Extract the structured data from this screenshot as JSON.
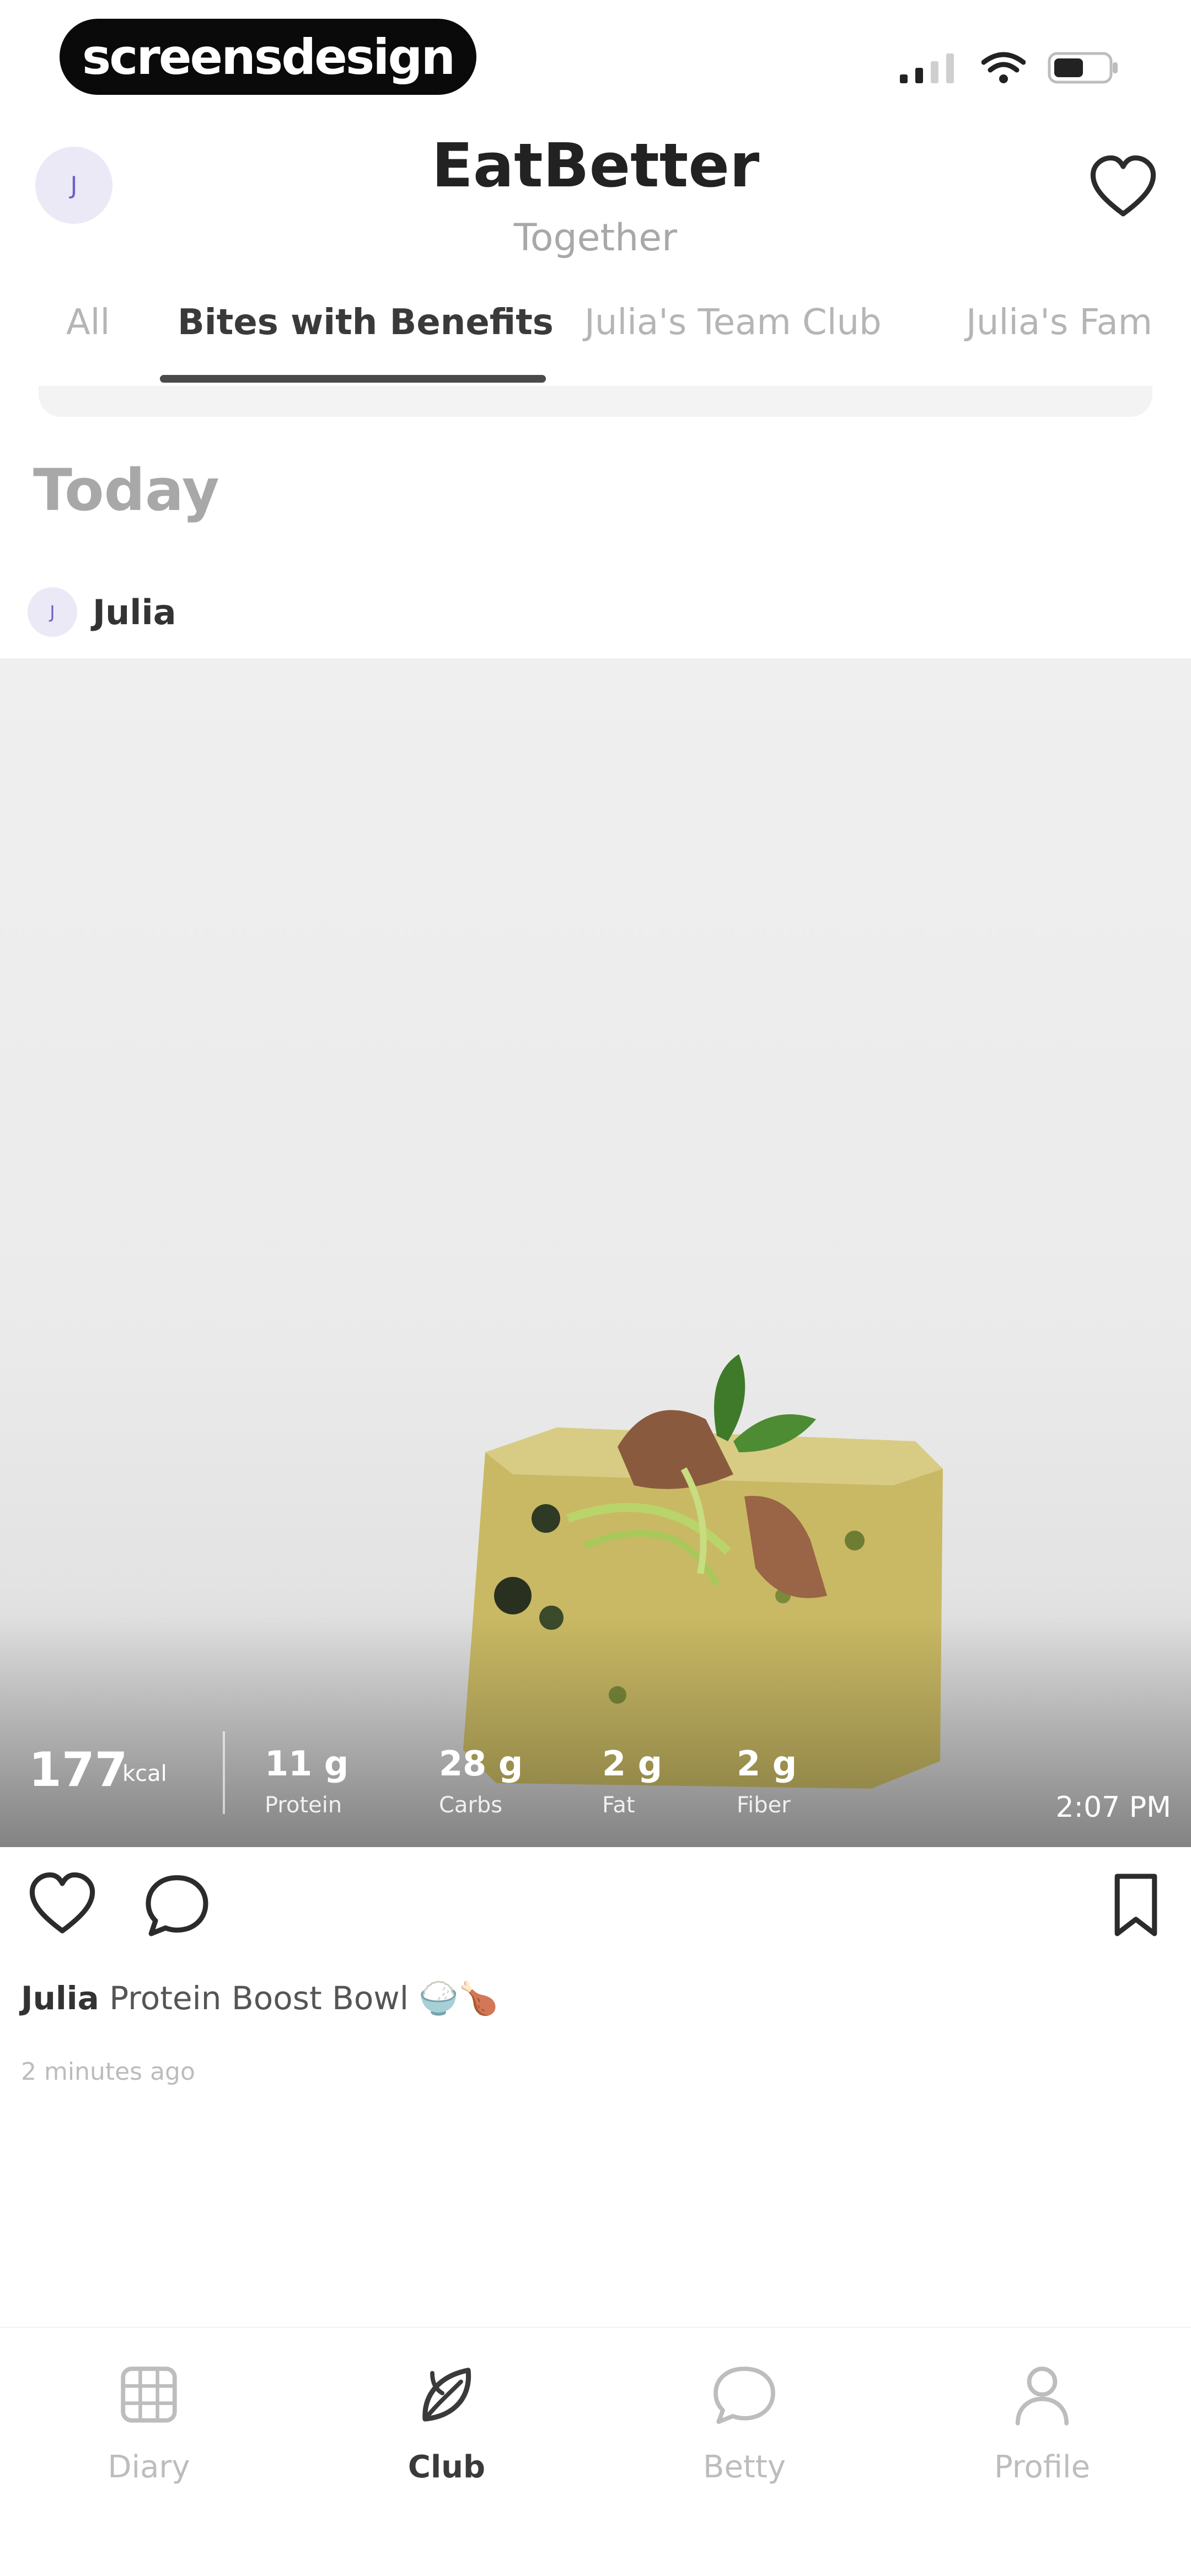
{
  "status_bar": {
    "badge_text": "screensdesign",
    "icons": [
      "signal-icon",
      "wifi-icon",
      "battery-icon"
    ]
  },
  "header": {
    "avatar_initial": "J",
    "title": "EatBetter",
    "subtitle": "Together",
    "favorite_icon": "heart-icon"
  },
  "tabs": [
    {
      "label": "All",
      "active": false
    },
    {
      "label": "Bites with Benefits",
      "active": true
    },
    {
      "label": "Julia's Team Club",
      "active": false
    },
    {
      "label": "Julia's Fam",
      "active": false
    }
  ],
  "feed": {
    "section_title": "Today",
    "post": {
      "author_initial": "J",
      "author": "Julia",
      "kcal_value": "177",
      "kcal_unit": "kcal",
      "macros": [
        {
          "value": "11 g",
          "label": "Protein"
        },
        {
          "value": "28 g",
          "label": "Carbs"
        },
        {
          "value": "2 g",
          "label": "Fat"
        },
        {
          "value": "2 g",
          "label": "Fiber"
        }
      ],
      "time": "2:07 PM",
      "caption_author": "Julia",
      "caption_text": "Protein Boost Bowl 🍚🍗",
      "posted_ago": "2 minutes ago"
    }
  },
  "bottom_nav": [
    {
      "label": "Diary",
      "icon": "grid-icon",
      "active": false
    },
    {
      "label": "Club",
      "icon": "leaf-icon",
      "active": true
    },
    {
      "label": "Betty",
      "icon": "chat-bubble-icon",
      "active": false
    },
    {
      "label": "Profile",
      "icon": "person-icon",
      "active": false
    }
  ],
  "colors": {
    "accent": "#6b63c8",
    "text_dark": "#222222",
    "text_muted": "#a8a8a8"
  }
}
